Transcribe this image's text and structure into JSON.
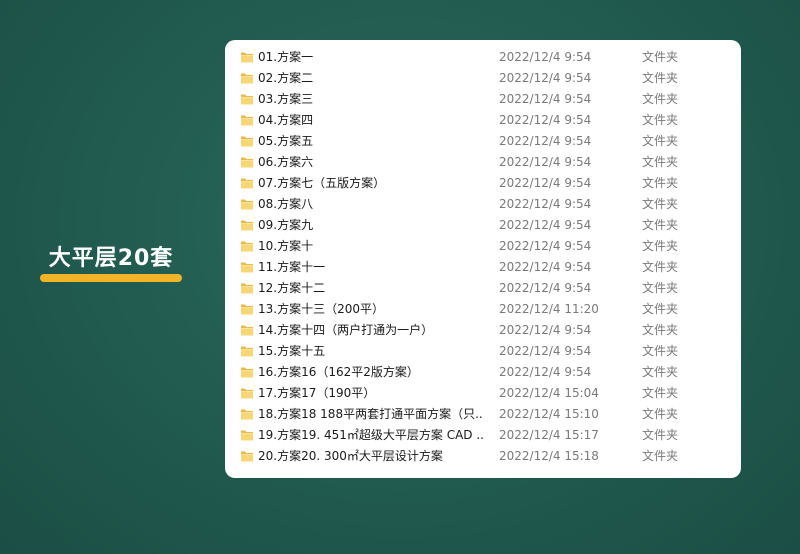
{
  "side_title": "大平层20套",
  "colors": {
    "background": "#225b50",
    "accent": "#f0b429",
    "folder": "#f7d675",
    "panel": "#ffffff"
  },
  "files": [
    {
      "name": "01.方案一",
      "date": "2022/12/4 9:54",
      "type": "文件夹"
    },
    {
      "name": "02.方案二",
      "date": "2022/12/4 9:54",
      "type": "文件夹"
    },
    {
      "name": "03.方案三",
      "date": "2022/12/4 9:54",
      "type": "文件夹"
    },
    {
      "name": "04.方案四",
      "date": "2022/12/4 9:54",
      "type": "文件夹"
    },
    {
      "name": "05.方案五",
      "date": "2022/12/4 9:54",
      "type": "文件夹"
    },
    {
      "name": "06.方案六",
      "date": "2022/12/4 9:54",
      "type": "文件夹"
    },
    {
      "name": "07.方案七（五版方案）",
      "date": "2022/12/4 9:54",
      "type": "文件夹"
    },
    {
      "name": "08.方案八",
      "date": "2022/12/4 9:54",
      "type": "文件夹"
    },
    {
      "name": "09.方案九",
      "date": "2022/12/4 9:54",
      "type": "文件夹"
    },
    {
      "name": "10.方案十",
      "date": "2022/12/4 9:54",
      "type": "文件夹"
    },
    {
      "name": "11.方案十一",
      "date": "2022/12/4 9:54",
      "type": "文件夹"
    },
    {
      "name": "12.方案十二",
      "date": "2022/12/4 9:54",
      "type": "文件夹"
    },
    {
      "name": "13.方案十三（200平）",
      "date": "2022/12/4 11:20",
      "type": "文件夹"
    },
    {
      "name": "14.方案十四（两户打通为一户）",
      "date": "2022/12/4 9:54",
      "type": "文件夹"
    },
    {
      "name": "15.方案十五",
      "date": "2022/12/4 9:54",
      "type": "文件夹"
    },
    {
      "name": "16.方案16（162平2版方案）",
      "date": "2022/12/4 9:54",
      "type": "文件夹"
    },
    {
      "name": "17.方案17（190平）",
      "date": "2022/12/4 15:04",
      "type": "文件夹"
    },
    {
      "name": "18.方案18 188平两套打通平面方案（只...",
      "date": "2022/12/4 15:10",
      "type": "文件夹"
    },
    {
      "name": "19.方案19. 451㎡超级大平层方案 CAD ...",
      "date": "2022/12/4 15:17",
      "type": "文件夹"
    },
    {
      "name": "20.方案20. 300㎡大平层设计方案",
      "date": "2022/12/4 15:18",
      "type": "文件夹"
    }
  ]
}
